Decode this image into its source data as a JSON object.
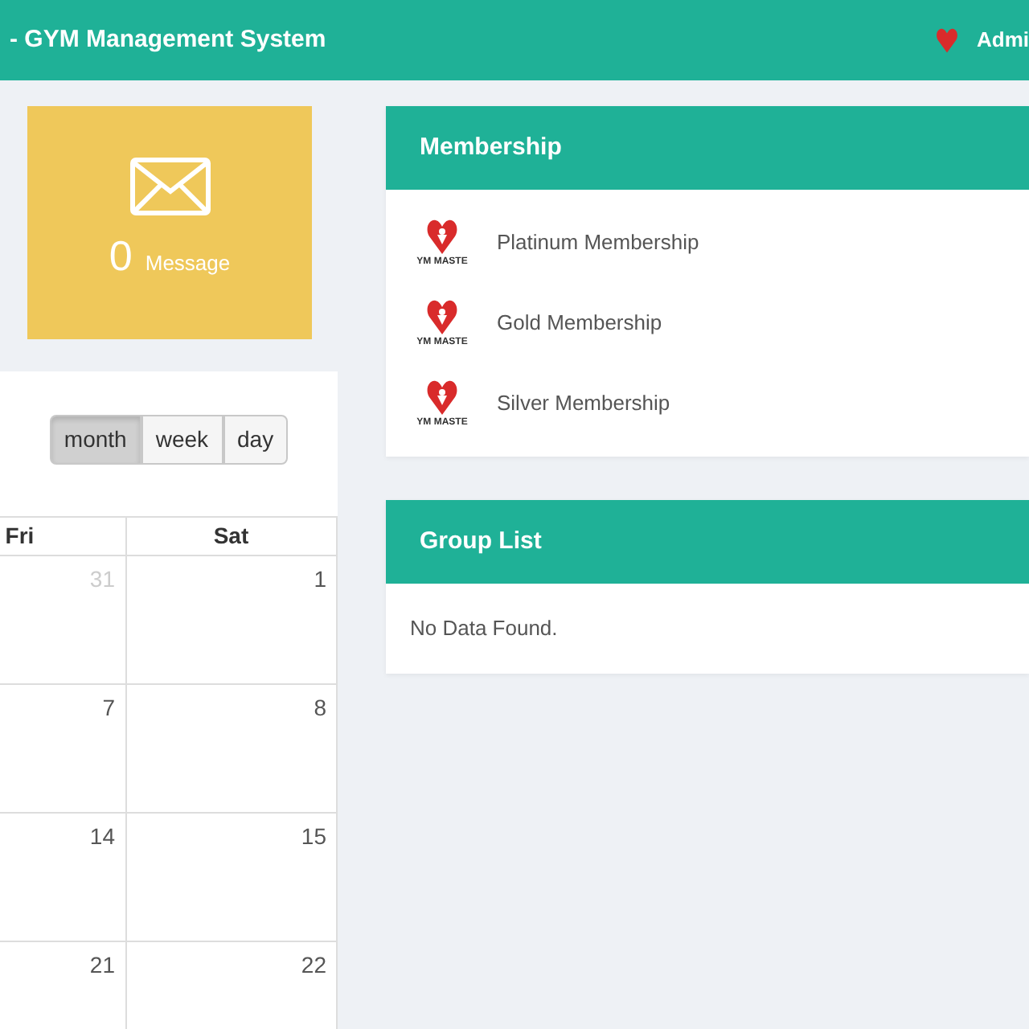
{
  "header": {
    "title": "- GYM Management System",
    "user": "Admi"
  },
  "message_card": {
    "count": "0",
    "label": "Message"
  },
  "calendar": {
    "views": [
      {
        "label": "month",
        "selected": true
      },
      {
        "label": "week",
        "selected": false
      },
      {
        "label": "day",
        "selected": false
      }
    ],
    "columns": [
      "Fri",
      "Sat"
    ],
    "weeks": [
      [
        {
          "day": "31",
          "other_month": true
        },
        {
          "day": "1",
          "other_month": false
        }
      ],
      [
        {
          "day": "7",
          "other_month": false
        },
        {
          "day": "8",
          "other_month": false
        }
      ],
      [
        {
          "day": "14",
          "other_month": false
        },
        {
          "day": "15",
          "other_month": false
        }
      ],
      [
        {
          "day": "21",
          "other_month": false
        },
        {
          "day": "22",
          "other_month": false
        }
      ]
    ]
  },
  "membership": {
    "title": "Membership",
    "items": [
      {
        "name": "Platinum Membership",
        "logo_caption": "YM MASTE"
      },
      {
        "name": "Gold Membership",
        "logo_caption": "YM MASTE"
      },
      {
        "name": "Silver Membership",
        "logo_caption": "YM MASTE"
      }
    ]
  },
  "group_list": {
    "title": "Group List",
    "empty_text": "No Data Found."
  }
}
